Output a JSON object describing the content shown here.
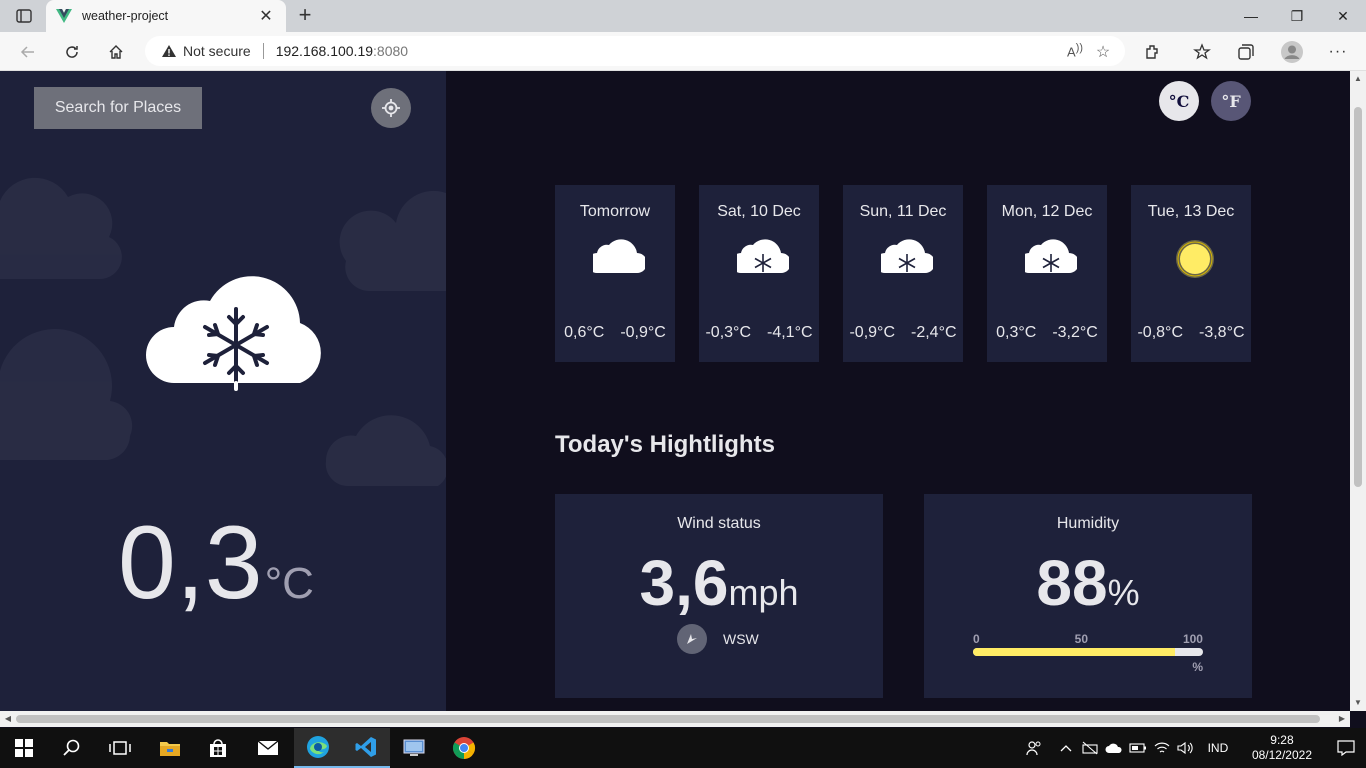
{
  "browser": {
    "tab_title": "weather-project",
    "security_label": "Not secure",
    "url_host": "192.168.100.19",
    "url_port": ":8080"
  },
  "sidebar": {
    "search_label": "Search for Places",
    "current_temp": "0,3",
    "current_unit": "°C",
    "condition_icon": "snow-cloud-icon"
  },
  "units": {
    "celsius": "°C",
    "fahrenheit": "°F",
    "active": "celsius"
  },
  "forecast": [
    {
      "day": "Tomorrow",
      "icon": "cloud-icon",
      "max": "0,6°C",
      "min": "-0,9°C"
    },
    {
      "day": "Sat, 10 Dec",
      "icon": "snow-cloud-icon",
      "max": "-0,3°C",
      "min": "-4,1°C"
    },
    {
      "day": "Sun, 11 Dec",
      "icon": "snow-cloud-icon",
      "max": "-0,9°C",
      "min": "-2,4°C"
    },
    {
      "day": "Mon, 12 Dec",
      "icon": "snow-cloud-icon",
      "max": "0,3°C",
      "min": "-3,2°C"
    },
    {
      "day": "Tue, 13 Dec",
      "icon": "sun-icon",
      "max": "-0,8°C",
      "min": "-3,8°C"
    }
  ],
  "highlights": {
    "title": "Today's Hightlights",
    "wind": {
      "label": "Wind status",
      "value": "3,6",
      "unit": "mph",
      "direction": "WSW"
    },
    "humidity": {
      "label": "Humidity",
      "value": "88",
      "unit": "%",
      "scale_0": "0",
      "scale_50": "50",
      "scale_100": "100",
      "scale_unit": "%",
      "level": 0.88
    }
  },
  "colors": {
    "accent_yellow": "#ffec65",
    "sidebar_bg": "#1e213a",
    "page_bg": "#100e1d"
  },
  "taskbar": {
    "language": "IND",
    "time": "9:28",
    "date": "08/12/2022"
  }
}
